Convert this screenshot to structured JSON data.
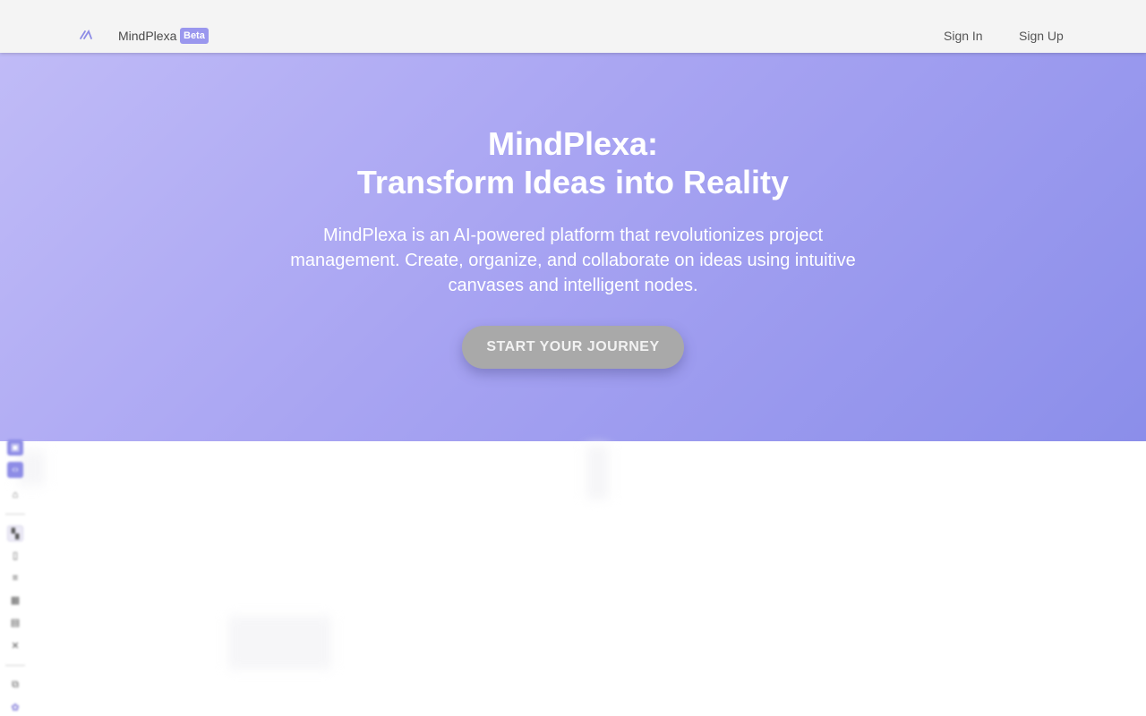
{
  "header": {
    "logo_icon": "mindplexa-logo-icon",
    "brand_name": "MindPlexa",
    "badge": "Beta",
    "sign_in": "Sign In",
    "sign_up": "Sign Up"
  },
  "hero": {
    "title_line1": "MindPlexa:",
    "title_line2": "Transform Ideas into Reality",
    "description": "MindPlexa is an AI-powered platform that revolutionizes project management. Create, organize, and collaborate on ideas using intuitive canvases and intelligent nodes.",
    "cta": "START YOUR JOURNEY"
  },
  "background_preview": {
    "sidebar_icons": [
      "app-icon",
      "code-icon",
      "home-icon",
      "dashboard-icon",
      "document-icon",
      "list-icon",
      "table-icon",
      "window-icon",
      "tools-icon",
      "hierarchy-icon",
      "brain-icon"
    ]
  },
  "colors": {
    "hero_gradient_start": "#c0bbf7",
    "hero_gradient_end": "#8b8eea",
    "badge": "#9a97ee",
    "cta_background": "#a9a9a9",
    "header_background": "#f4f4f4"
  }
}
